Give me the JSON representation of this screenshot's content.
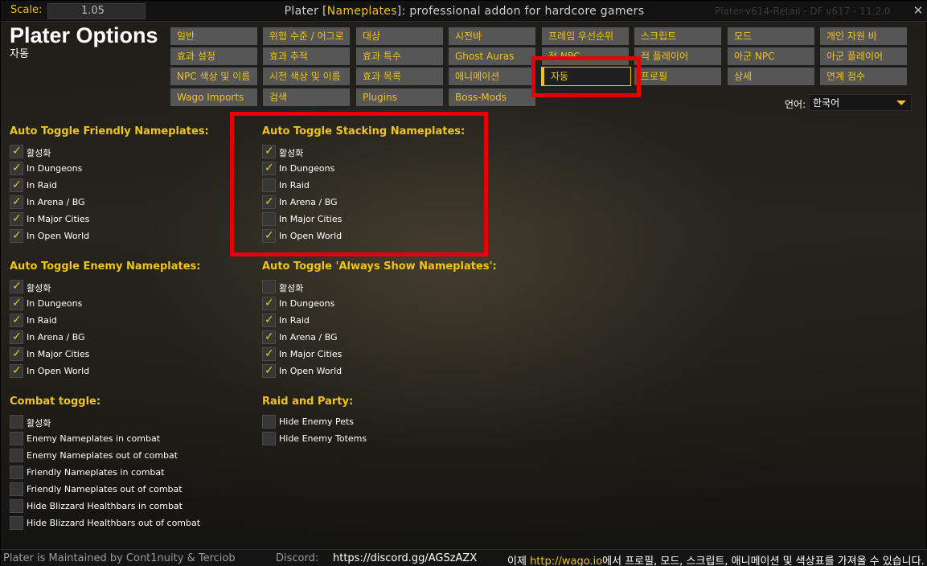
{
  "titlebar": {
    "scale_label": "Scale:",
    "scale_value": "1.05",
    "title_prefix": "Plater [",
    "title_highlight": "Nameplates",
    "title_suffix": "]: professional addon for hardcore gamers",
    "version": "Plater-v614-Retail - DF v617 - 11.2.0",
    "close_glyph": "✕"
  },
  "header": {
    "app_title": "Plater Options",
    "subtitle": "자동"
  },
  "tabs": [
    [
      "일반",
      "위협 수준 / 어그로",
      "대상",
      "시전바",
      "프레임 우선순위",
      "스크립트",
      "모드",
      "개인 자원 바"
    ],
    [
      "효과 설정",
      "효과 추적",
      "효과 특수",
      "Ghost Auras",
      "적 NPC",
      "적 플레이어",
      "아군 NPC",
      "아군 플레이어"
    ],
    [
      "NPC 색상 및 이름",
      "시전 색상 및 이름",
      "효과 목록",
      "애니메이션",
      "자동",
      "프로필",
      "상세",
      "연계 점수"
    ],
    [
      "Wago Imports",
      "검색",
      "Plugins",
      "Boss-Mods"
    ]
  ],
  "selected_tab": "자동",
  "language": {
    "label": "언어:",
    "value": "한국어"
  },
  "sections": {
    "friendly": {
      "title": "Auto Toggle Friendly Nameplates:",
      "options": [
        {
          "label": "활성화",
          "checked": true
        },
        {
          "label": "In Dungeons",
          "checked": true
        },
        {
          "label": "In Raid",
          "checked": true
        },
        {
          "label": "In Arena / BG",
          "checked": true
        },
        {
          "label": "In Major Cities",
          "checked": true
        },
        {
          "label": "In Open World",
          "checked": true
        }
      ]
    },
    "stacking": {
      "title": "Auto Toggle Stacking Nameplates:",
      "options": [
        {
          "label": "활성화",
          "checked": true
        },
        {
          "label": "In Dungeons",
          "checked": true
        },
        {
          "label": "In Raid",
          "checked": false
        },
        {
          "label": "In Arena / BG",
          "checked": true
        },
        {
          "label": "In Major Cities",
          "checked": false
        },
        {
          "label": "In Open World",
          "checked": true
        }
      ]
    },
    "enemy": {
      "title": "Auto Toggle Enemy Nameplates:",
      "options": [
        {
          "label": "활성화",
          "checked": true
        },
        {
          "label": "In Dungeons",
          "checked": true
        },
        {
          "label": "In Raid",
          "checked": true
        },
        {
          "label": "In Arena / BG",
          "checked": true
        },
        {
          "label": "In Major Cities",
          "checked": true
        },
        {
          "label": "In Open World",
          "checked": true
        }
      ]
    },
    "always_show": {
      "title": "Auto Toggle 'Always Show Nameplates':",
      "options": [
        {
          "label": "활성화",
          "checked": false
        },
        {
          "label": "In Dungeons",
          "checked": true
        },
        {
          "label": "In Raid",
          "checked": true
        },
        {
          "label": "In Arena / BG",
          "checked": true
        },
        {
          "label": "In Major Cities",
          "checked": true
        },
        {
          "label": "In Open World",
          "checked": true
        }
      ]
    },
    "combat": {
      "title": "Combat toggle:",
      "options": [
        {
          "label": "활성화",
          "checked": false
        },
        {
          "label": "Enemy Nameplates in combat",
          "checked": false
        },
        {
          "label": "Enemy Nameplates out of combat",
          "checked": false
        },
        {
          "label": "Friendly Nameplates in combat",
          "checked": false
        },
        {
          "label": "Friendly Nameplates out of combat",
          "checked": false
        },
        {
          "label": "Hide Blizzard Healthbars in combat",
          "checked": false
        },
        {
          "label": "Hide Blizzard Healthbars out of combat",
          "checked": false
        }
      ]
    },
    "raid_party": {
      "title": "Raid and Party:",
      "options": [
        {
          "label": "Hide Enemy Pets",
          "checked": false
        },
        {
          "label": "Hide Enemy Totems",
          "checked": false
        }
      ]
    }
  },
  "statusbar": {
    "maintained": "Plater is Maintained by Cont1nuity & Terciob",
    "discord_label": "Discord:",
    "discord_url": "https://discord.gg/AGSzAZX",
    "wago_prefix": "이제 ",
    "wago_link": "http://wago.io",
    "wago_suffix": "에서 프로필, 모드, 스크립트, 애니메이션 및 색상표를 가져올 수 있습니다."
  },
  "colors": {
    "accent": "#f0c419",
    "highlight_box": "#e60000",
    "tab_bg": "#565656",
    "checkbox_bg": "#363636"
  },
  "icons": {
    "check": "check-icon",
    "dropdown": "chevron-down-icon",
    "close": "close-icon"
  }
}
